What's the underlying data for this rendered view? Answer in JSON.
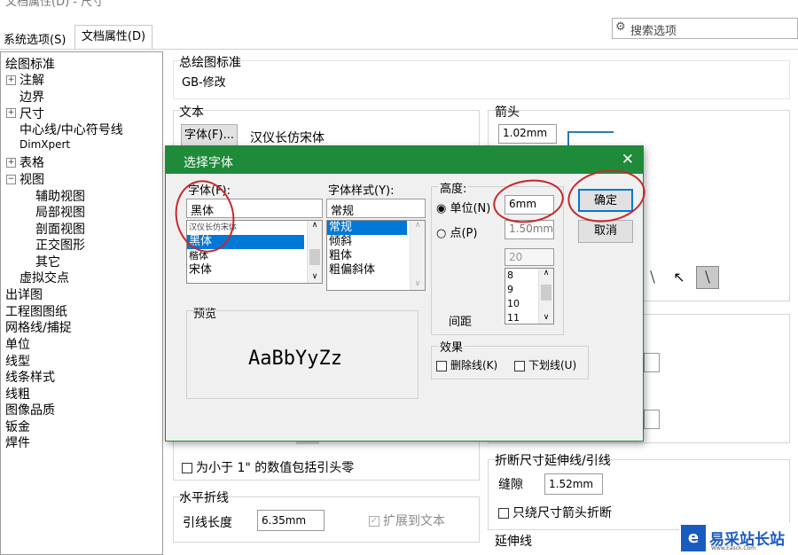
{
  "window_title": "文档属性(D) - 尺寸",
  "tabs": [
    {
      "label": "系统选项(S)"
    },
    {
      "label": "文档属性(D)"
    }
  ],
  "search": {
    "placeholder": "搜索选项"
  },
  "tree": [
    "绘图标准",
    "注解",
    "边界",
    "尺寸",
    "中心线/中心符号线",
    "DimXpert",
    "表格",
    "视图",
    "辅助视图",
    "局部视图",
    "剖面视图",
    "正交图形",
    "其它",
    "虚拟交点",
    "出详图",
    "工程图图纸",
    "网格线/捕捉",
    "单位",
    "线型",
    "线条样式",
    "线粗",
    "图像品质",
    "钣金",
    "焊件"
  ],
  "main": {
    "standard_label": "总绘图标准",
    "standard_value": "GB-修改",
    "text_label": "文本",
    "font_button": "字体(F)...",
    "font_name": "汉仪长仿宋体",
    "arrow_label": "箭头",
    "arrow_value": "1.02mm",
    "include_leading_zero": "为小于 1\" 的数值包括引头零",
    "horizontal_break_label": "水平折线",
    "leader_length_label": "引线长度",
    "leader_length_value": "6.35mm",
    "extend_to_text": "扩展到文本",
    "break_dim_label": "折断尺寸延伸线/引线",
    "gap_label": "缝隙",
    "gap_value": "1.52mm",
    "only_arrow_break": "只绕尺寸箭头折断",
    "extension_label": "延伸线"
  },
  "dialog": {
    "title": "选择字体",
    "close_glyph": "✕",
    "font_label": "字体(F):",
    "font_input": "黑体",
    "font_list": [
      "汉仪长仿宋体",
      "黑体",
      "楷体",
      "宋体"
    ],
    "font_selected": "黑体",
    "style_label": "字体样式(Y):",
    "style_input": "常规",
    "style_list": [
      "常规",
      "倾斜",
      "粗体",
      "粗偏斜体"
    ],
    "style_selected": "常规",
    "height_label": "高度:",
    "unit_radio": "单位(N)",
    "unit_value": "6mm",
    "point_radio": "点(P)",
    "point_value": "1.50mm",
    "point_size_input": "20",
    "point_sizes": [
      "8",
      "9",
      "10",
      "11"
    ],
    "spacing_label": "间距",
    "ok_button": "确定",
    "cancel_button": "取消",
    "preview_label": "预览",
    "preview_text": "AaBbYyZz",
    "effects_label": "效果",
    "strike_label": "删除线(K)",
    "underline_label": "下划线(U)"
  },
  "watermark": {
    "text": "易采站长站",
    "sub": "Www.Easck.Com"
  },
  "colors": {
    "dialog_title_bg": "#1e8a3a",
    "selection": "#0078d7",
    "annotation": "#c4292b"
  }
}
